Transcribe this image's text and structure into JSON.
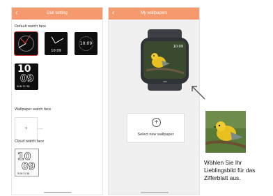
{
  "left_screen": {
    "back_icon": "chevron-left-icon",
    "title": "Dial setting",
    "default_section_label": "Default watch face",
    "wallpaper_section_label": "Wallpaper watch face",
    "cloud_section_label": "Cloud watch face",
    "face2_time": "10:09",
    "face3_time": "10:09",
    "face4": {
      "hour": "10",
      "minute": "09",
      "small": "SUN  21  58"
    },
    "cloud_face": {
      "hour": "10",
      "minute": "09",
      "small": "SUN  21  58"
    },
    "add_icon": "plus-icon"
  },
  "right_screen": {
    "back_icon": "chevron-left-icon",
    "title": "My wallpapers",
    "select_label": "Select new wallpaper",
    "select_icon": "circle-plus-icon",
    "screen_time": "10:09"
  },
  "pointer_arrow": "arrow-icon",
  "caption": "Wählen Sie Ihr Lieblingsbild für das Zifferblatt aus.",
  "colors": {
    "header": "#f49a6e",
    "bird_yellow": "#e8c020"
  }
}
